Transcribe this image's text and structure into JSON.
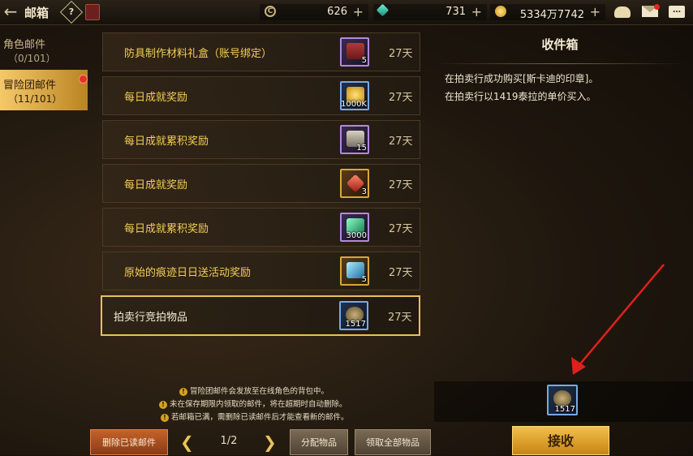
{
  "header": {
    "title": "邮箱",
    "help_label": "?",
    "currencies": [
      {
        "icon": "c-coin-icon",
        "value": "626"
      },
      {
        "icon": "gem-icon",
        "value": "731"
      },
      {
        "icon": "gold-coin-icon",
        "value": "5334万7742"
      }
    ],
    "plus": "+"
  },
  "sidebar": {
    "items": [
      {
        "label": "角色邮件",
        "count": "（0/101）",
        "active": false
      },
      {
        "label": "冒险团邮件",
        "count": "（11/101）",
        "active": true
      }
    ]
  },
  "mails": [
    {
      "title": "防具制作材料礼盒（账号绑定）",
      "days": "27天",
      "qty": "5",
      "icon": "gift-box-icon",
      "frame": "purple"
    },
    {
      "title": "每日成就奖励",
      "days": "27天",
      "qty": "1000K",
      "icon": "gold-coins-icon",
      "frame": "blue"
    },
    {
      "title": "每日成就累积奖励",
      "days": "27天",
      "qty": "15",
      "icon": "ticket-icon",
      "frame": "purple"
    },
    {
      "title": "每日成就奖励",
      "days": "27天",
      "qty": "3",
      "icon": "red-crystal-icon",
      "frame": "gold"
    },
    {
      "title": "每日成就累积奖励",
      "days": "27天",
      "qty": "3000",
      "icon": "green-crystal-icon",
      "frame": "purple"
    },
    {
      "title": "原始的痕迹日日送活动奖励",
      "days": "27天",
      "qty": "5",
      "icon": "blue-crystal-icon",
      "frame": "gold"
    },
    {
      "title": "拍卖行竞拍物品",
      "days": "27天",
      "qty": "1517",
      "icon": "seal-icon",
      "frame": "blue",
      "selected": true
    }
  ],
  "notes": [
    "冒险团邮件会发放至在线角色的背包中。",
    "未在保存期限内领取的邮件，将在超期时自动删除。",
    "若邮箱已满，需删除已读邮件后才能查看新的邮件。"
  ],
  "footer": {
    "delete_read_label": "删除已读邮件",
    "page": "1/2",
    "distribute_label": "分配物品",
    "receive_all_label": "领取全部物品"
  },
  "detail": {
    "title": "收件箱",
    "lines": [
      "在拍卖行成功购买[斯卡迪的印章]。",
      "在拍卖行以1419泰拉的单价买入。"
    ],
    "attachment_qty": "1517",
    "receive_label": "接收"
  }
}
